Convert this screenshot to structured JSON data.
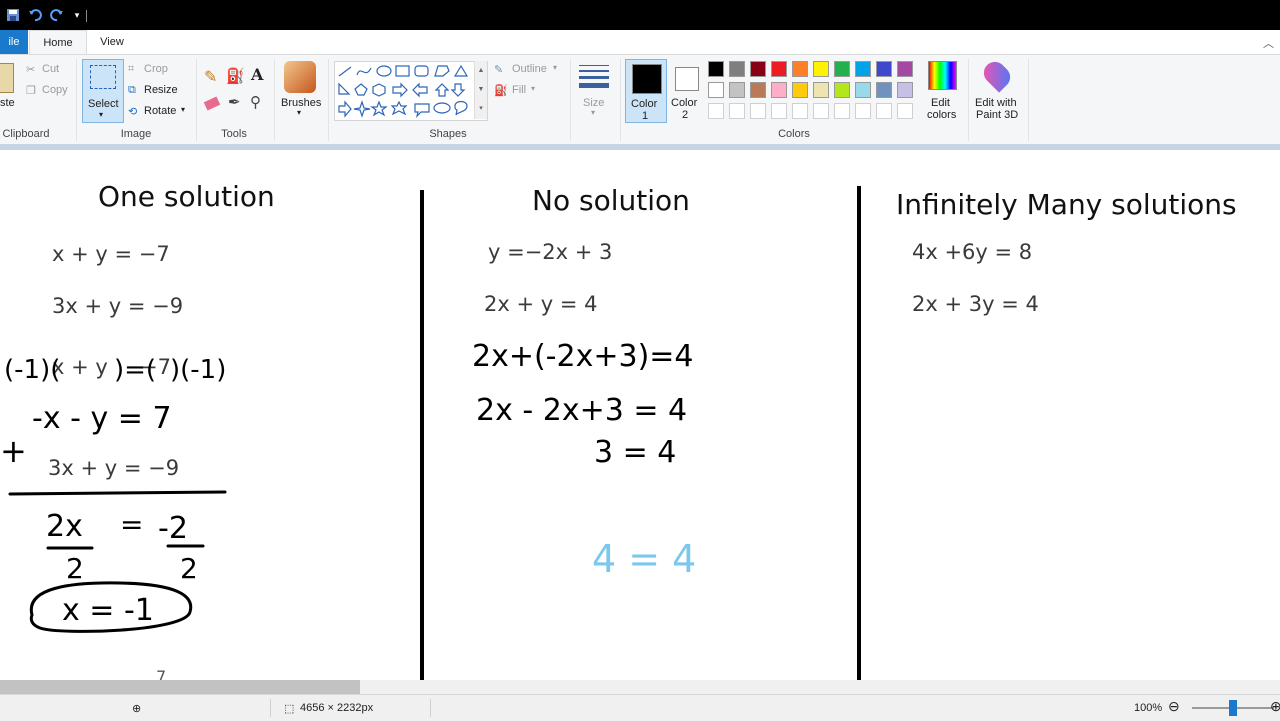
{
  "tabs": [
    "ile",
    "Home",
    "View"
  ],
  "ribbon": {
    "clipboard": {
      "paste": "ste",
      "cut": "Cut",
      "copy": "Copy",
      "label": "Clipboard"
    },
    "image": {
      "select": "Select",
      "crop": "Crop",
      "resize": "Resize",
      "rotate": "Rotate",
      "label": "Image"
    },
    "tools": {
      "label": "Tools"
    },
    "brushes": {
      "label": "Brushes"
    },
    "shapes": {
      "outline": "Outline",
      "fill": "Fill",
      "label": "Shapes"
    },
    "size": {
      "label": "Size"
    },
    "colors": {
      "color1": "Color",
      "color1_num": "1",
      "color2": "Color",
      "color2_num": "2",
      "edit_colors": "Edit",
      "edit_colors2": "colors",
      "edit_paint3d": "Edit with",
      "edit_paint3d2": "Paint 3D",
      "label": "Colors",
      "row1": [
        "#000000",
        "#7f7f7f",
        "#880015",
        "#ed1c24",
        "#ff7f27",
        "#fff200",
        "#22b14c",
        "#00a2e8",
        "#3f48cc",
        "#a349a4"
      ],
      "row2": [
        "#ffffff",
        "#c3c3c3",
        "#b97a57",
        "#ffaec9",
        "#ffc90e",
        "#efe4b0",
        "#b5e61d",
        "#99d9ea",
        "#7092be",
        "#c8bfe7"
      ]
    }
  },
  "canvas": {
    "col1": {
      "heading": "One solution",
      "eq1": "x + y = −7",
      "eq2": "3x + y = −9",
      "eq3": "x + y",
      "eq3b": "−7",
      "eq4": "3x + y = −9",
      "hand": [
        "(-1)(",
        ")=(",
        ")(-1)",
        "-x - y = 7",
        "+",
        "2x",
        "=",
        "-2",
        "2",
        "2",
        "x = -1",
        "7"
      ]
    },
    "col2": {
      "heading": "No solution",
      "eq1": "y =−2x + 3",
      "eq2": "2x + y = 4",
      "hand": [
        "2x+(-2x+3)=4",
        "2x - 2x+3 = 4",
        "3 = 4",
        "4 = 4"
      ]
    },
    "col3": {
      "heading": "Infinitely Many solutions",
      "eq1": "4x +6y = 8",
      "eq2": "2x + 3y = 4"
    }
  },
  "status": {
    "dimensions": "4656 × 2232px",
    "zoom": "100%",
    "zoom_level": 0.5
  }
}
